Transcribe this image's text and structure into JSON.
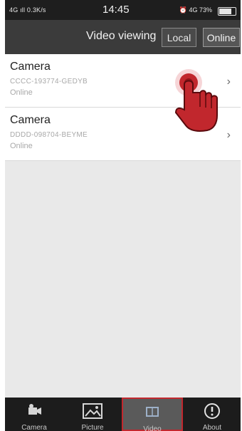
{
  "status_bar": {
    "network": "4G",
    "speed": "0.3K/s",
    "time": "14:45",
    "right_network": "4G",
    "battery": "73%"
  },
  "header": {
    "title": "Video viewing",
    "local_button": "Local",
    "online_button": "Online"
  },
  "devices": [
    {
      "name": "Camera",
      "id": "CCCC-193774-GEDYB",
      "status": "Online"
    },
    {
      "name": "Camera",
      "id": "DDDD-098704-BEYME",
      "status": "Online"
    }
  ],
  "tabs": [
    {
      "label": "Camera",
      "icon": "camera-icon"
    },
    {
      "label": "Picture",
      "icon": "picture-icon"
    },
    {
      "label": "Video",
      "icon": "video-icon"
    },
    {
      "label": "About",
      "icon": "info-icon"
    }
  ],
  "colors": {
    "header_bg": "#3b3b3b",
    "statusbar_bg": "#1e1e1e",
    "tabbar_bg": "#1c1c1c",
    "highlight": "#c1272d"
  }
}
